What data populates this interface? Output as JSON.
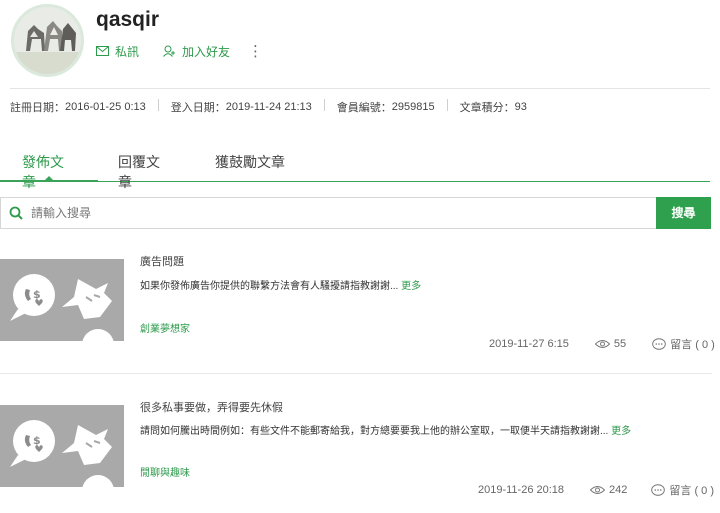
{
  "profile": {
    "username": "qasqir",
    "message_label": "私訊",
    "add_friend_label": "加入好友",
    "more_label": "⋮"
  },
  "stats": {
    "registered_label": "註冊日期：",
    "registered_value": "2016-01-25 0:13",
    "login_label": "登入日期：",
    "login_value": "2019-11-24 21:13",
    "member_no_label": "會員編號：",
    "member_no_value": "2959815",
    "points_label": "文章積分：",
    "points_value": "93"
  },
  "tabs": [
    {
      "label": "發佈文章",
      "active": true
    },
    {
      "label": "回覆文章",
      "active": false
    },
    {
      "label": "獲鼓勵文章",
      "active": false
    }
  ],
  "search": {
    "placeholder": "請輸入搜尋",
    "button_label": "搜尋"
  },
  "posts": [
    {
      "title": "廣告問題",
      "excerpt": "如果你發佈廣告你提供的聯繫方法會有人騷擾請指教謝謝...",
      "more_label": "更多",
      "category": "創業夢想家",
      "date": "2019-11-27 6:15",
      "views": "55",
      "comments": "留言 ( 0 )"
    },
    {
      "title": "很多私事要做，弄得要先休假",
      "excerpt": "請問如何騰出時間例如：有些文件不能郵寄給我，對方總要要我上他的辦公室取，一取便半天請指教謝謝...",
      "more_label": "更多",
      "category": "閒聊與趣味",
      "date": "2019-11-26 20:18",
      "views": "242",
      "comments": "留言 ( 0 )"
    }
  ],
  "colors": {
    "accent": "#2e9a4c",
    "thumb_bg": "#a9a9a9"
  }
}
